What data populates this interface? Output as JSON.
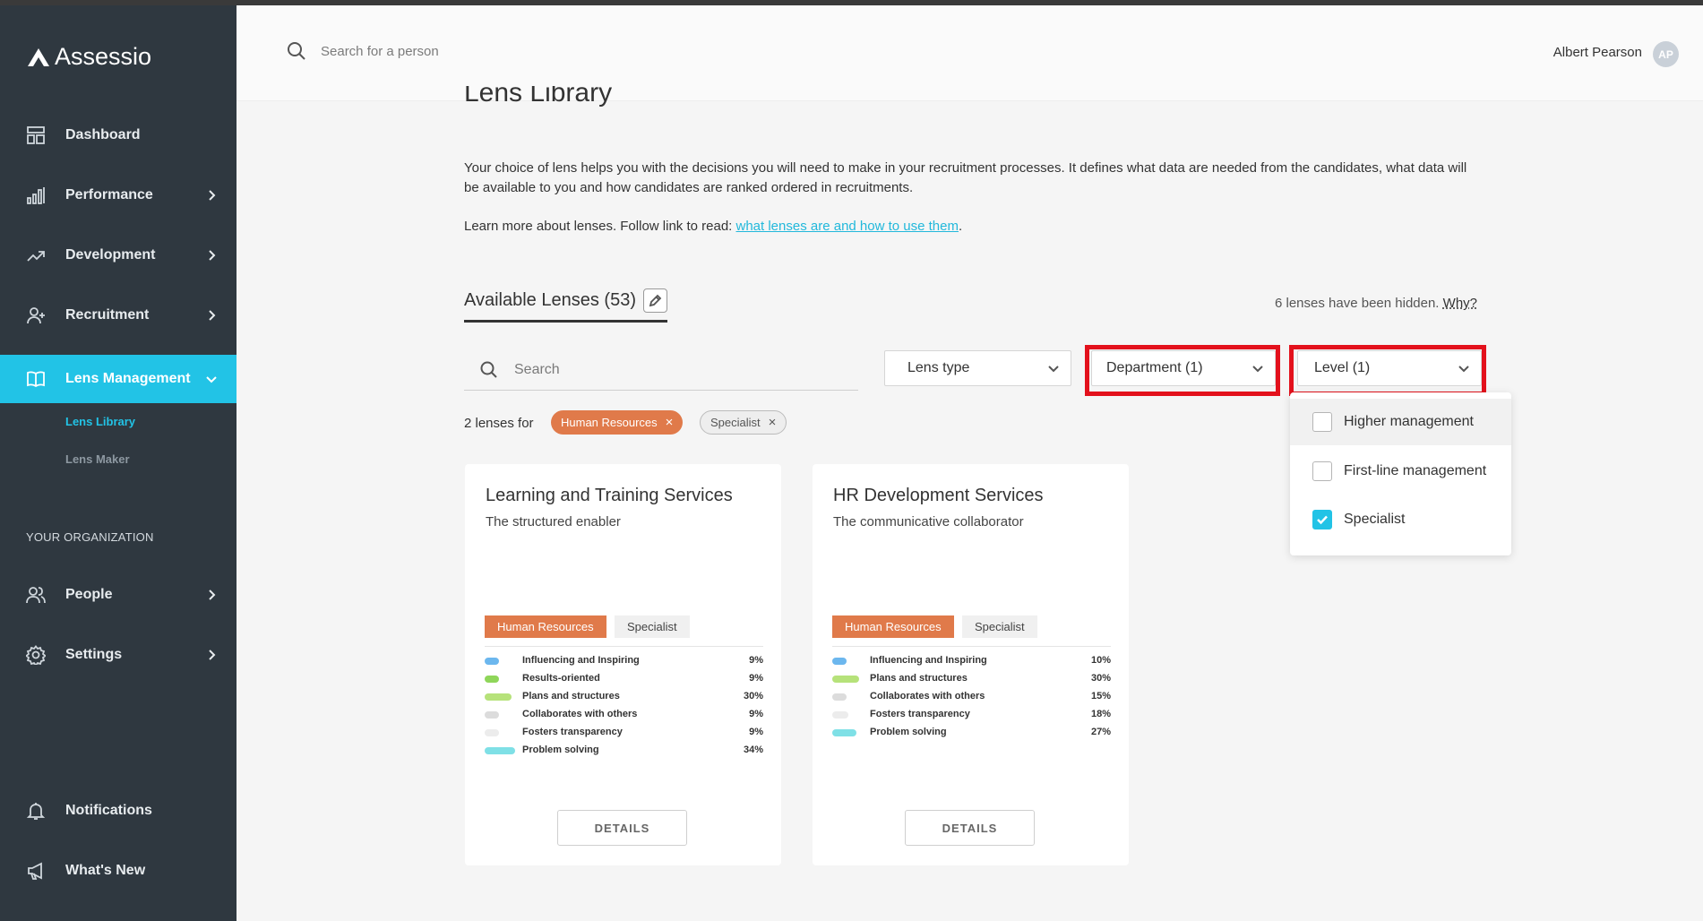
{
  "app": {
    "name": "Assessio"
  },
  "header": {
    "search_placeholder": "Search for a person",
    "user_name": "Albert Pearson",
    "user_initials": "AP"
  },
  "sidebar": {
    "items": [
      {
        "label": "Dashboard",
        "icon": "dashboard-icon"
      },
      {
        "label": "Performance",
        "icon": "bar-chart-icon",
        "has_children": true
      },
      {
        "label": "Development",
        "icon": "trend-up-icon",
        "has_children": true
      },
      {
        "label": "Recruitment",
        "icon": "add-user-icon",
        "has_children": true
      },
      {
        "label": "Lens Management",
        "icon": "book-icon",
        "has_children": true,
        "active": true
      }
    ],
    "sub_items": [
      {
        "label": "Lens Library",
        "active": true
      },
      {
        "label": "Lens Maker",
        "active": false
      }
    ],
    "section_label": "YOUR ORGANIZATION",
    "org_items": [
      {
        "label": "People",
        "icon": "people-icon",
        "has_children": true
      },
      {
        "label": "Settings",
        "icon": "gear-icon",
        "has_children": true
      }
    ],
    "bottom_items": [
      {
        "label": "Notifications",
        "icon": "bell-icon"
      },
      {
        "label": "What's New",
        "icon": "megaphone-icon"
      }
    ]
  },
  "main": {
    "title": "Lens Library",
    "intro": "Your choice of lens helps you with the decisions you will need to make in your recruitment processes. It defines what data are needed from the candidates, what data will be available to you and how candidates are ranked ordered in recruitments.",
    "learn_prefix": "Learn more about lenses. Follow link to read: ",
    "learn_link": "what lenses are and how to use them",
    "learn_suffix": ".",
    "tab_label": "Available Lenses (53)",
    "hidden_note": "6 lenses have been hidden.",
    "hidden_why": "Why?",
    "search_placeholder": "Search",
    "filters": {
      "lens_type": "Lens type",
      "department": "Department (1)",
      "level": "Level (1)"
    },
    "level_options": [
      {
        "label": "Higher management",
        "checked": false
      },
      {
        "label": "First-line management",
        "checked": false
      },
      {
        "label": "Specialist",
        "checked": true
      }
    ],
    "result_text": "2 lenses for",
    "active_chips": [
      "Human Resources",
      "Specialist"
    ],
    "details_label": "DETAILS",
    "cards": [
      {
        "title": "Learning and Training Services",
        "subtitle": "The structured enabler",
        "tags": [
          "Human Resources",
          "Specialist"
        ],
        "competencies": [
          {
            "name": "Influencing and Inspiring",
            "pct": "9%",
            "color": "#6cb7ee",
            "bar": 0.09
          },
          {
            "name": "Results-oriented",
            "pct": "9%",
            "color": "#8fd65a",
            "bar": 0.09
          },
          {
            "name": "Plans and structures",
            "pct": "30%",
            "color": "#b6e27a",
            "bar": 0.3
          },
          {
            "name": "Collaborates with others",
            "pct": "9%",
            "color": "#dcdcdc",
            "bar": 0.09
          },
          {
            "name": "Fosters transparency",
            "pct": "9%",
            "color": "#ececec",
            "bar": 0.09
          },
          {
            "name": "Problem solving",
            "pct": "34%",
            "color": "#7fe0e6",
            "bar": 0.34
          }
        ]
      },
      {
        "title": "HR Development Services",
        "subtitle": "The communicative collaborator",
        "tags": [
          "Human Resources",
          "Specialist"
        ],
        "competencies": [
          {
            "name": "Influencing and Inspiring",
            "pct": "10%",
            "color": "#6cb7ee",
            "bar": 0.1
          },
          {
            "name": "Plans and structures",
            "pct": "30%",
            "color": "#b6e27a",
            "bar": 0.3
          },
          {
            "name": "Collaborates with others",
            "pct": "15%",
            "color": "#dcdcdc",
            "bar": 0.15
          },
          {
            "name": "Fosters transparency",
            "pct": "18%",
            "color": "#ececec",
            "bar": 0.18
          },
          {
            "name": "Problem solving",
            "pct": "27%",
            "color": "#7fe0e6",
            "bar": 0.27
          }
        ]
      }
    ]
  },
  "colors": {
    "sidebar_bg": "#2f3840",
    "accent": "#22c3e6",
    "tag_orange": "#e07a4a",
    "highlight_red": "#e3111c"
  }
}
